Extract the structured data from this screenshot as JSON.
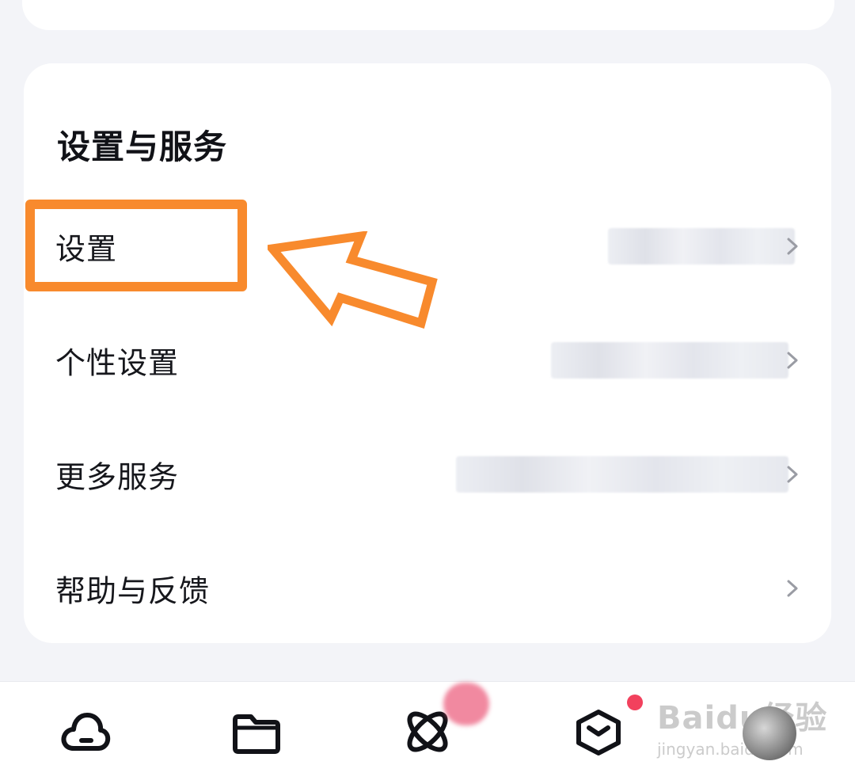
{
  "section": {
    "title": "设置与服务"
  },
  "menu": {
    "items": [
      {
        "label": "设置"
      },
      {
        "label": "个性设置"
      },
      {
        "label": "更多服务"
      },
      {
        "label": "帮助与反馈"
      }
    ]
  },
  "bottom_nav": {
    "tabs": [
      {
        "icon": "cloud-icon"
      },
      {
        "icon": "folder-icon"
      },
      {
        "icon": "atom-icon"
      },
      {
        "icon": "box-icon"
      },
      {
        "icon": "avatar"
      }
    ]
  },
  "watermark": {
    "main": "Baidu经验",
    "sub": "jingyan.baidu.com"
  },
  "colors": {
    "highlight": "#f88a2d",
    "badge": "#f2415d",
    "background": "#f3f4f8"
  }
}
